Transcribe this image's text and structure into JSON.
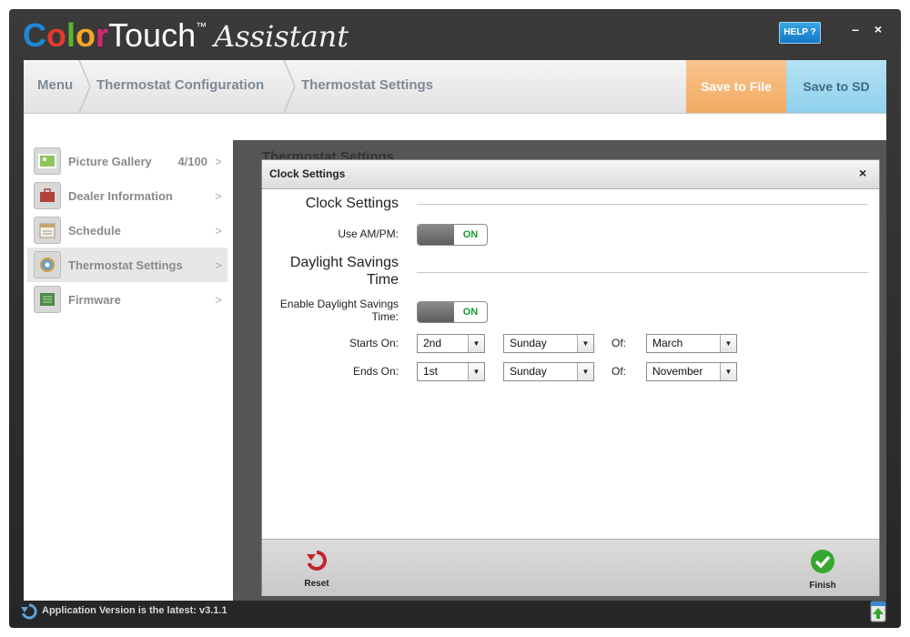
{
  "header": {
    "logo_c": "C",
    "logo_o1": "o",
    "logo_l": "l",
    "logo_o2": "o",
    "logo_r": "r",
    "logo_touch": "Touch",
    "logo_tm": "™",
    "logo_assistant": "Assistant",
    "help_label": "HELP ?",
    "minimize_label": "–",
    "close_label": "×"
  },
  "breadcrumb": {
    "items": [
      "Menu",
      "Thermostat Configuration",
      "Thermostat Settings"
    ],
    "save_file_label": "Save to File",
    "save_sd_label": "Save to SD"
  },
  "sidebar": {
    "items": [
      {
        "label": "Picture Gallery",
        "count": "4/100",
        "arrow": ">",
        "icon": "picture-gallery-icon"
      },
      {
        "label": "Dealer Information",
        "arrow": ">",
        "icon": "dealer-information-icon"
      },
      {
        "label": "Schedule",
        "arrow": ">",
        "icon": "schedule-icon"
      },
      {
        "label": "Thermostat Settings",
        "arrow": ">",
        "icon": "thermostat-settings-icon",
        "active": true
      },
      {
        "label": "Firmware",
        "arrow": ">",
        "icon": "firmware-icon"
      }
    ]
  },
  "background": {
    "title": "Thermostat Settings"
  },
  "dialog": {
    "title": "Clock Settings",
    "close_label": "×",
    "clock_section": "Clock Settings",
    "ampm_label": "Use AM/PM:",
    "ampm_toggle": "ON",
    "dst_section_line1": "Daylight Savings",
    "dst_section_line2": "Time",
    "dst_enable_line1": "Enable Daylight Savings",
    "dst_enable_line2": "Time:",
    "dst_toggle": "ON",
    "starts_label": "Starts On:",
    "ends_label": "Ends On:",
    "of_label": "Of:",
    "starts": {
      "week": "2nd",
      "day": "Sunday",
      "month": "March"
    },
    "ends": {
      "week": "1st",
      "day": "Sunday",
      "month": "November"
    },
    "reset_label": "Reset",
    "finish_label": "Finish"
  },
  "status": {
    "text": "Application Version is the latest: v3.1.1"
  },
  "colors": {
    "logo_c": "#1e88d4",
    "logo_o1": "#e23b2c",
    "logo_l": "#5cb531",
    "logo_o2": "#f5a623",
    "logo_r": "#d9266f",
    "toggle_on": "#199a2b",
    "save_file": "#f2aa63",
    "save_sd": "#8fd0ec",
    "help": "#1e8fd6"
  }
}
